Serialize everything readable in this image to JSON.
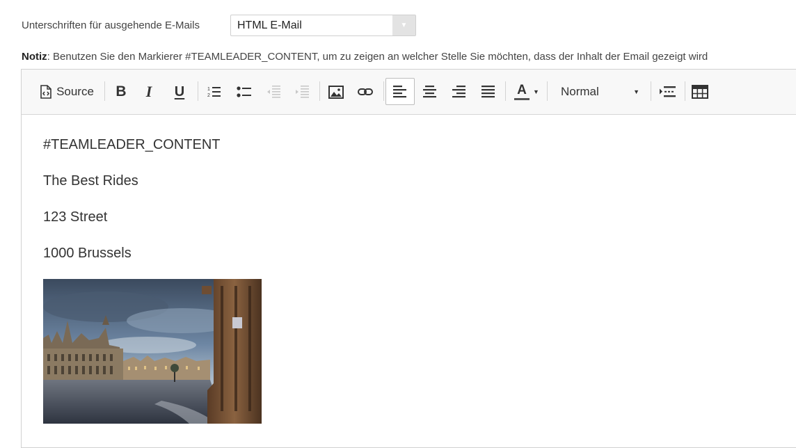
{
  "signature": {
    "label": "Unterschriften für ausgehende E-Mails",
    "select_value": "HTML E-Mail"
  },
  "note": {
    "bold": "Notiz",
    "text": ": Benutzen Sie den Markierer #TEAMLEADER_CONTENT, um zu zeigen an welcher Stelle Sie möchten, dass der Inhalt der Email gezeigt wird"
  },
  "toolbar": {
    "source_label": "Source",
    "bold_label": "B",
    "italic_label": "I",
    "underline_label": "U",
    "font_color_label": "A",
    "format_value": "Normal"
  },
  "content": {
    "paragraphs": [
      "#TEAMLEADER_CONTENT",
      "The Best Rides",
      "123 Street",
      "1000 Brussels"
    ]
  }
}
